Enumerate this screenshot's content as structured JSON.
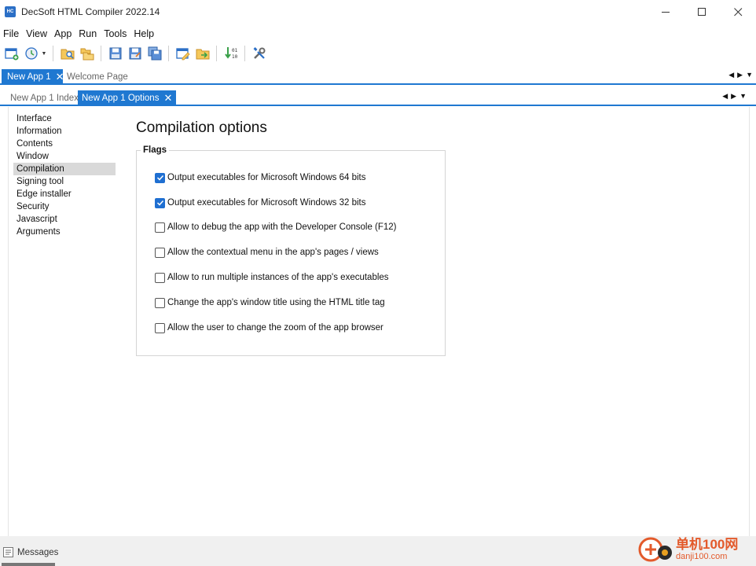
{
  "window": {
    "title": "DecSoft HTML Compiler 2022.14",
    "logo_text": "HC"
  },
  "menu": [
    "File",
    "View",
    "App",
    "Run",
    "Tools",
    "Help"
  ],
  "toolbar": {
    "icons": [
      "new-app-icon",
      "open-recent-icon",
      "find-icon",
      "open-folder-icon",
      "save-icon",
      "save-as-icon",
      "save-all-icon",
      "edit-page-icon",
      "export-icon",
      "compile-icon",
      "settings-tools-icon"
    ]
  },
  "tabs_main": [
    {
      "label": "New App 1",
      "active": true
    },
    {
      "label": "Welcome Page",
      "active": false
    }
  ],
  "tabs_sub": [
    {
      "label": "New App 1 Index",
      "active": false
    },
    {
      "label": "New App 1 Options",
      "active": true
    }
  ],
  "sidenav": {
    "items": [
      "Interface",
      "Information",
      "Contents",
      "Window",
      "Compilation",
      "Signing tool",
      "Edge installer",
      "Security",
      "Javascript",
      "Arguments"
    ],
    "selected": "Compilation"
  },
  "page": {
    "title": "Compilation options",
    "flags_legend": "Flags",
    "flags": [
      {
        "label": "Output executables for Microsoft Windows 64 bits",
        "checked": true
      },
      {
        "label": "Output executables for Microsoft Windows 32 bits",
        "checked": true
      },
      {
        "label": "Allow to debug the app with the Developer Console (F12)",
        "checked": false
      },
      {
        "label": "Allow the contextual menu in the app's pages / views",
        "checked": false
      },
      {
        "label": "Allow to run multiple instances of the app's executables",
        "checked": false
      },
      {
        "label": "Change the app's window title using the HTML title tag",
        "checked": false
      },
      {
        "label": "Allow the user to change the zoom of the app browser",
        "checked": false
      }
    ]
  },
  "status": {
    "messages_label": "Messages"
  },
  "watermark": {
    "cn": "单机100网",
    "url": "danji100.com"
  },
  "colors": {
    "accent": "#1f78d1",
    "checkbox": "#1f6fd1",
    "watermark": "#e35a2b"
  }
}
